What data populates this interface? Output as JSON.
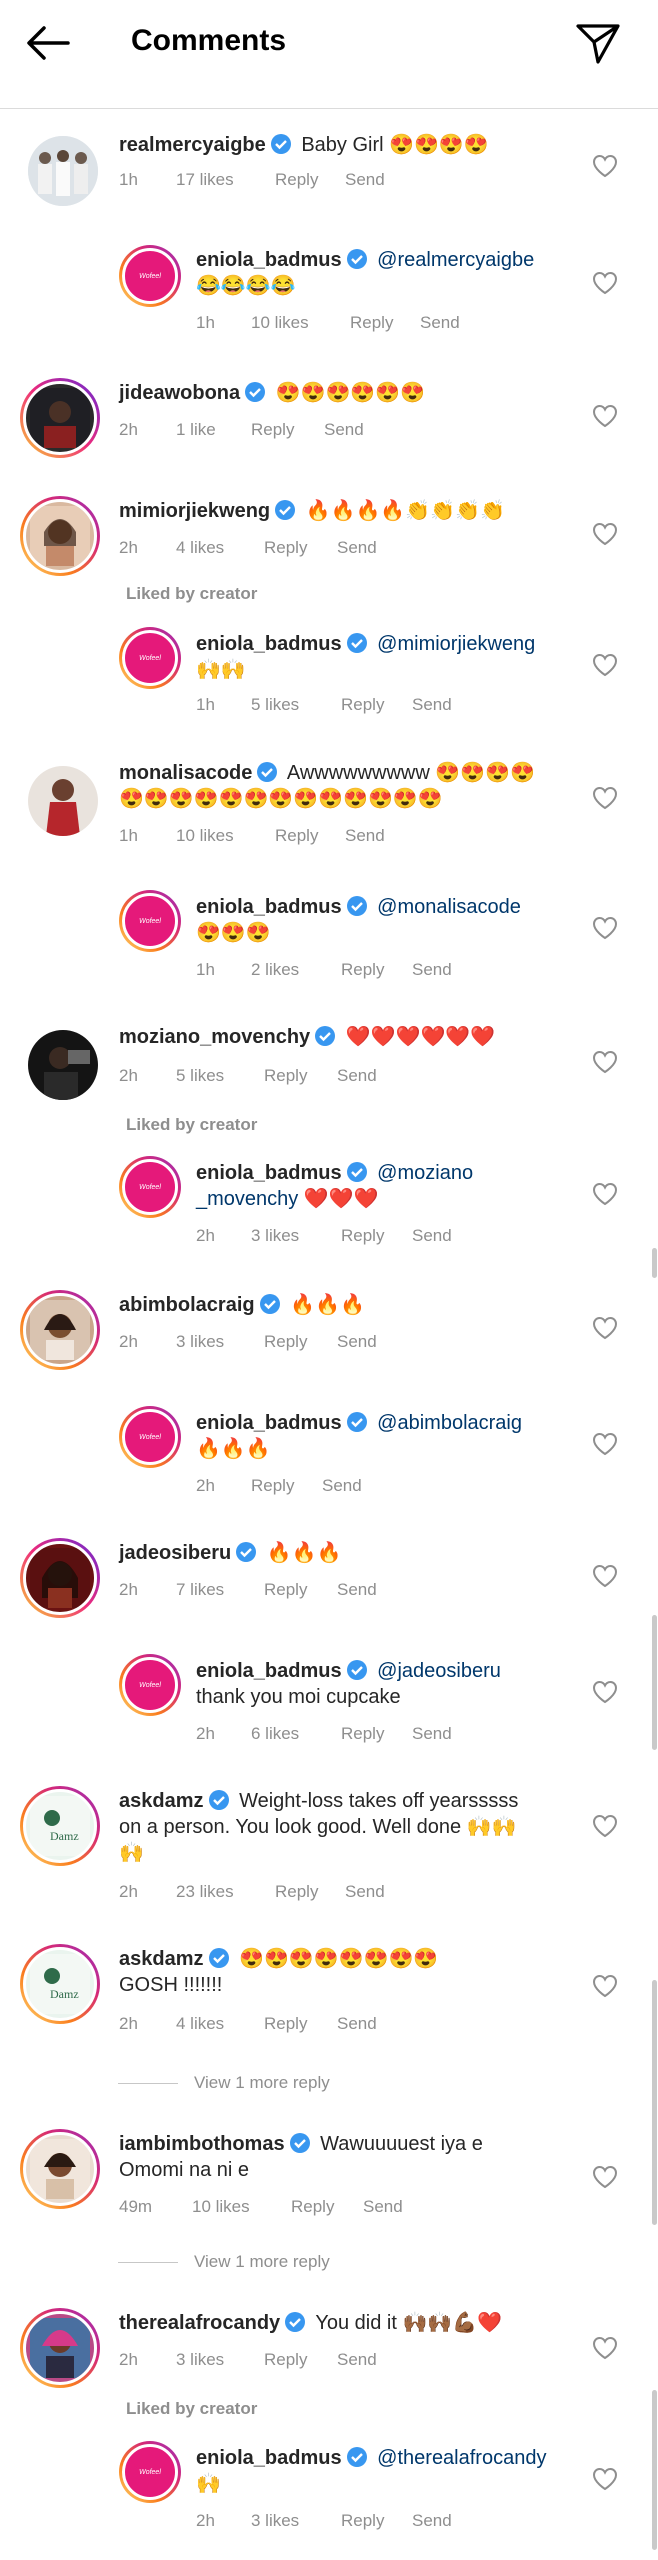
{
  "header": {
    "title": "Comments",
    "back_icon": "arrow-left-icon",
    "send_icon": "paper-plane-icon"
  },
  "colors": {
    "mention": "#00376b",
    "verified": "#3897f0",
    "meta": "#8e8e8e"
  },
  "comments": [
    {
      "username": "realmercyaigbe",
      "text": "Baby Girl 😍😍😍😍",
      "time": "1h",
      "likes": "17 likes",
      "reply": "Reply",
      "send": "Send"
    },
    {
      "username": "eniola_badmus",
      "mention": "@realmercyaigbe",
      "text": "😂😂😂😂",
      "time": "1h",
      "likes": "10 likes",
      "reply": "Reply",
      "send": "Send"
    },
    {
      "username": "jideawobona",
      "text": "😍😍😍😍😍😍",
      "time": "2h",
      "likes": "1 like",
      "reply": "Reply",
      "send": "Send"
    },
    {
      "username": "mimiorjiekweng",
      "text": "🔥🔥🔥🔥👏👏👏👏",
      "time": "2h",
      "likes": "4 likes",
      "reply": "Reply",
      "send": "Send"
    },
    {
      "username": "eniola_badmus",
      "mention": "@mimiorjiekweng",
      "text": "🙌🙌",
      "time": "1h",
      "likes": "5 likes",
      "reply": "Reply",
      "send": "Send"
    },
    {
      "username": "monalisacode",
      "text": "Awwwwwwwww 😍😍😍😍",
      "text2": "😍😍😍😍😍😍😍😍😍😍😍😍😍",
      "time": "1h",
      "likes": "10 likes",
      "reply": "Reply",
      "send": "Send"
    },
    {
      "username": "eniola_badmus",
      "mention": "@monalisacode",
      "text": "😍😍😍",
      "time": "1h",
      "likes": "2 likes",
      "reply": "Reply",
      "send": "Send"
    },
    {
      "username": "moziano_movenchy",
      "text": "❤️❤️❤️❤️❤️❤️",
      "time": "2h",
      "likes": "5 likes",
      "reply": "Reply",
      "send": "Send"
    },
    {
      "username": "eniola_badmus",
      "mention": "@moziano",
      "mention2": "_movenchy",
      "text": "❤️❤️❤️",
      "time": "2h",
      "likes": "3 likes",
      "reply": "Reply",
      "send": "Send"
    },
    {
      "username": "abimbolacraig",
      "text": "🔥🔥🔥",
      "time": "2h",
      "likes": "3 likes",
      "reply": "Reply",
      "send": "Send"
    },
    {
      "username": "eniola_badmus",
      "mention": "@abimbolacraig",
      "text": "🔥🔥🔥",
      "time": "2h",
      "reply": "Reply",
      "send": "Send"
    },
    {
      "username": "jadeosiberu",
      "text": "🔥🔥🔥",
      "time": "2h",
      "likes": "7 likes",
      "reply": "Reply",
      "send": "Send"
    },
    {
      "username": "eniola_badmus",
      "mention": "@jadeosiberu",
      "text": "thank you moi cupcake",
      "time": "2h",
      "likes": "6 likes",
      "reply": "Reply",
      "send": "Send"
    },
    {
      "username": "askdamz",
      "text": "Weight-loss takes off yearsssss",
      "text2": "on a person. You look good. Well done 🙌🙌",
      "text3": "🙌",
      "time": "2h",
      "likes": "23 likes",
      "reply": "Reply",
      "send": "Send"
    },
    {
      "username": "askdamz",
      "text": "😍😍😍😍😍😍😍😍",
      "text2": "GOSH !!!!!!!",
      "time": "2h",
      "likes": "4 likes",
      "reply": "Reply",
      "send": "Send"
    },
    {
      "username": "iambimbothomas",
      "text": "Wawuuuuest iya e",
      "text2": "Omomi na ni e",
      "time": "49m",
      "likes": "10 likes",
      "reply": "Reply",
      "send": "Send"
    },
    {
      "username": "therealafrocandy",
      "text": "You did it 🙌🏾🙌🏾💪🏾❤️",
      "time": "2h",
      "likes": "3 likes",
      "reply": "Reply",
      "send": "Send"
    },
    {
      "username": "eniola_badmus",
      "mention": "@therealafrocandy",
      "text": "🙌",
      "time": "2h",
      "likes": "3 likes",
      "reply": "Reply",
      "send": "Send"
    }
  ],
  "liked_by_creator": "Liked by creator",
  "view_more": "View 1 more reply",
  "avatar_badge": "Wofeel"
}
